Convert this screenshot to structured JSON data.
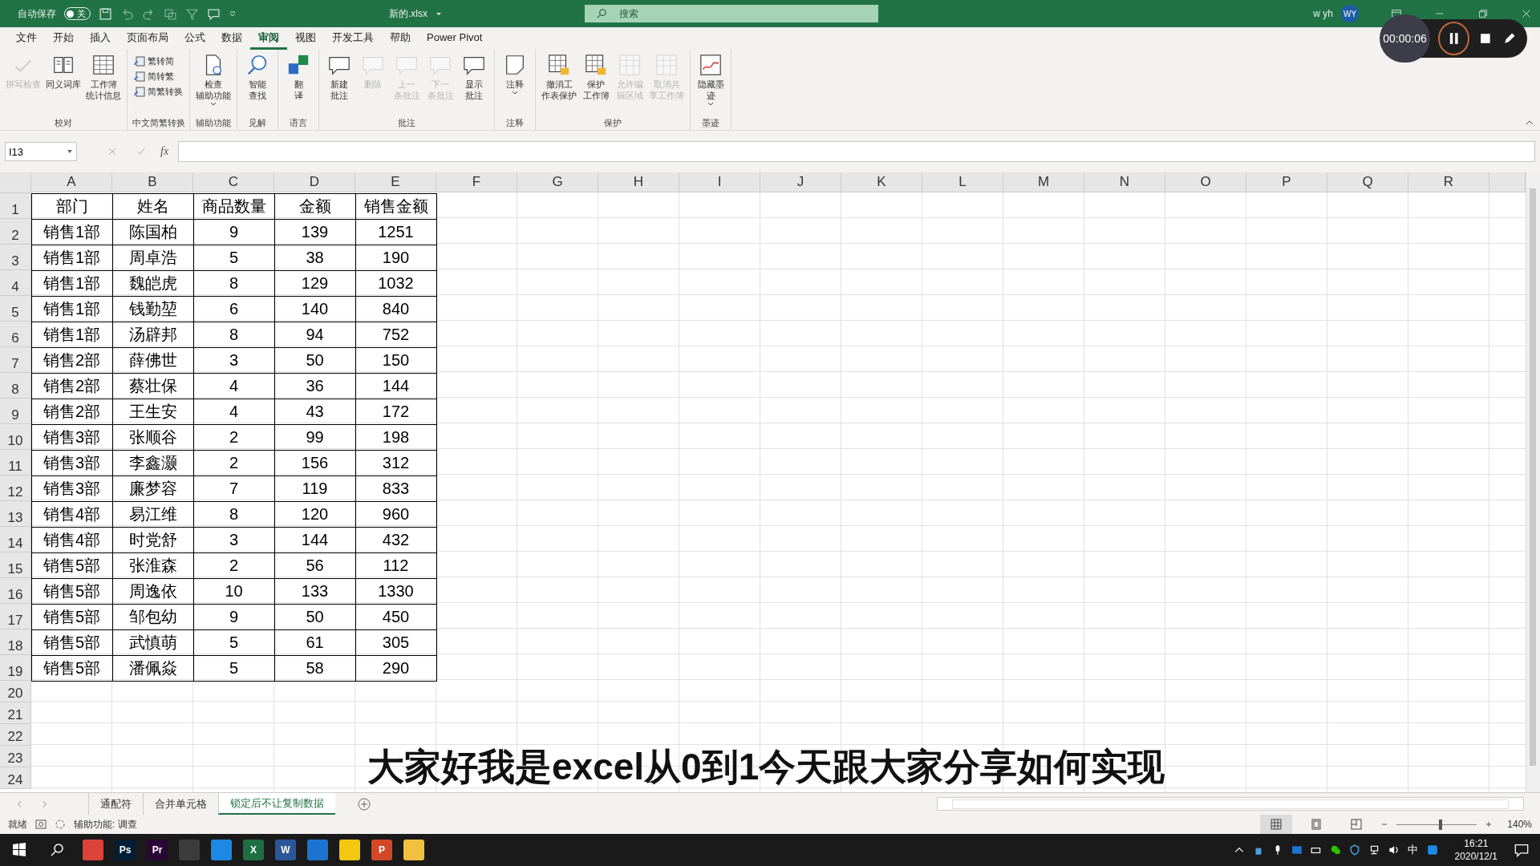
{
  "title_bar": {
    "autosave_label": "自动保存",
    "autosave": {
      "on": false,
      "label": "关"
    },
    "filename": "新的.xlsx",
    "search_placeholder": "搜索",
    "user_name": "w yh",
    "avatar": "WY"
  },
  "menu_tabs": [
    {
      "label": "文件",
      "selected": false
    },
    {
      "label": "开始",
      "selected": false
    },
    {
      "label": "插入",
      "selected": false
    },
    {
      "label": "页面布局",
      "selected": false
    },
    {
      "label": "公式",
      "selected": false
    },
    {
      "label": "数据",
      "selected": false
    },
    {
      "label": "审阅",
      "selected": true
    },
    {
      "label": "视图",
      "selected": false
    },
    {
      "label": "开发工具",
      "selected": false
    },
    {
      "label": "帮助",
      "selected": false
    },
    {
      "label": "Power Pivot",
      "selected": false
    }
  ],
  "ribbon_groups": [
    {
      "label": "校对",
      "kind": "large",
      "buttons": [
        {
          "lines": [
            "拼写检查"
          ],
          "disabled": true,
          "dropdown": false
        },
        {
          "lines": [
            "同义词库"
          ],
          "disabled": false,
          "dropdown": false
        },
        {
          "lines": [
            "工作簿",
            "统计信息"
          ],
          "disabled": false,
          "dropdown": false
        }
      ]
    },
    {
      "label": "中文简繁转换",
      "kind": "small",
      "buttons": [
        {
          "lines": [
            "繁转简"
          ],
          "disabled": false
        },
        {
          "lines": [
            "简转繁"
          ],
          "disabled": false
        },
        {
          "lines": [
            "简繁转换"
          ],
          "disabled": false
        }
      ]
    },
    {
      "label": "辅助功能",
      "kind": "large",
      "buttons": [
        {
          "lines": [
            "检查",
            "辅助功能"
          ],
          "disabled": false,
          "dropdown": true
        }
      ]
    },
    {
      "label": "见解",
      "kind": "large",
      "buttons": [
        {
          "lines": [
            "智能",
            "查找"
          ],
          "disabled": false,
          "dropdown": false
        }
      ]
    },
    {
      "label": "语言",
      "kind": "large",
      "buttons": [
        {
          "lines": [
            "翻",
            "译"
          ],
          "disabled": false,
          "dropdown": false
        }
      ]
    },
    {
      "label": "批注",
      "kind": "large",
      "buttons": [
        {
          "lines": [
            "新建",
            "批注"
          ],
          "disabled": false,
          "dropdown": false
        },
        {
          "lines": [
            "删除"
          ],
          "disabled": true,
          "dropdown": false
        },
        {
          "lines": [
            "上一",
            "条批注"
          ],
          "disabled": true,
          "dropdown": false
        },
        {
          "lines": [
            "下一",
            "条批注"
          ],
          "disabled": true,
          "dropdown": false
        },
        {
          "lines": [
            "显示",
            "批注"
          ],
          "disabled": false,
          "dropdown": false
        }
      ]
    },
    {
      "label": "注释",
      "kind": "large",
      "buttons": [
        {
          "lines": [
            "注释"
          ],
          "disabled": false,
          "dropdown": true
        }
      ]
    },
    {
      "label": "保护",
      "kind": "large",
      "buttons": [
        {
          "lines": [
            "撤消工",
            "作表保护"
          ],
          "disabled": false,
          "dropdown": false
        },
        {
          "lines": [
            "保护",
            "工作簿"
          ],
          "disabled": false,
          "dropdown": false
        },
        {
          "lines": [
            "允许编",
            "辑区域"
          ],
          "disabled": true,
          "dropdown": false
        },
        {
          "lines": [
            "取消共",
            "享工作簿"
          ],
          "disabled": true,
          "dropdown": false
        }
      ]
    },
    {
      "label": "墨迹",
      "kind": "large",
      "buttons": [
        {
          "lines": [
            "隐藏墨",
            "迹"
          ],
          "disabled": false,
          "dropdown": true
        }
      ]
    }
  ],
  "formula_bar": {
    "name_box": "I13",
    "fx": "fx"
  },
  "sheet": {
    "columns": [
      "A",
      "B",
      "C",
      "D",
      "E",
      "F",
      "G",
      "H",
      "I",
      "J",
      "K",
      "L",
      "M",
      "N",
      "O",
      "P",
      "Q",
      "R"
    ],
    "rows": [
      {
        "header": "1",
        "cells": [
          "部门",
          "姓名",
          "商品数量",
          "金额",
          "销售金额"
        ]
      },
      {
        "header": "2",
        "cells": [
          "销售1部",
          "陈国柏",
          "9",
          "139",
          "1251"
        ]
      },
      {
        "header": "3",
        "cells": [
          "销售1部",
          "周卓浩",
          "5",
          "38",
          "190"
        ]
      },
      {
        "header": "4",
        "cells": [
          "销售1部",
          "魏皑虎",
          "8",
          "129",
          "1032"
        ]
      },
      {
        "header": "5",
        "cells": [
          "销售1部",
          "钱勤堃",
          "6",
          "140",
          "840"
        ]
      },
      {
        "header": "6",
        "cells": [
          "销售1部",
          "汤辟邦",
          "8",
          "94",
          "752"
        ]
      },
      {
        "header": "7",
        "cells": [
          "销售2部",
          "薛佛世",
          "3",
          "50",
          "150"
        ]
      },
      {
        "header": "8",
        "cells": [
          "销售2部",
          "蔡壮保",
          "4",
          "36",
          "144"
        ]
      },
      {
        "header": "9",
        "cells": [
          "销售2部",
          "王生安",
          "4",
          "43",
          "172"
        ]
      },
      {
        "header": "10",
        "cells": [
          "销售3部",
          "张顺谷",
          "2",
          "99",
          "198"
        ]
      },
      {
        "header": "11",
        "cells": [
          "销售3部",
          "李鑫灏",
          "2",
          "156",
          "312"
        ]
      },
      {
        "header": "12",
        "cells": [
          "销售3部",
          "廉梦容",
          "7",
          "119",
          "833"
        ]
      },
      {
        "header": "13",
        "cells": [
          "销售4部",
          "易江维",
          "8",
          "120",
          "960"
        ]
      },
      {
        "header": "14",
        "cells": [
          "销售4部",
          "时党舒",
          "3",
          "144",
          "432"
        ]
      },
      {
        "header": "15",
        "cells": [
          "销售5部",
          "张淮森",
          "2",
          "56",
          "112"
        ]
      },
      {
        "header": "16",
        "cells": [
          "销售5部",
          "周逸依",
          "10",
          "133",
          "1330"
        ]
      },
      {
        "header": "17",
        "cells": [
          "销售5部",
          "邹包幼",
          "9",
          "50",
          "450"
        ]
      },
      {
        "header": "18",
        "cells": [
          "销售5部",
          "武慎萌",
          "5",
          "61",
          "305"
        ]
      },
      {
        "header": "19",
        "cells": [
          "销售5部",
          "潘佩焱",
          "5",
          "58",
          "290"
        ]
      },
      {
        "header": "20"
      },
      {
        "header": "21"
      },
      {
        "header": "22"
      },
      {
        "header": "23"
      },
      {
        "header": "24"
      }
    ]
  },
  "caption": "大家好我是excel从0到1今天跟大家分享如何实现",
  "sheet_tabs": [
    {
      "label": "通配符",
      "selected": false
    },
    {
      "label": "合并单元格",
      "selected": false
    },
    {
      "label": "锁定后不让复制数据",
      "selected": true
    }
  ],
  "status_bar": {
    "ready": "就绪",
    "accessibility": "辅助功能: 调查",
    "views": [
      {
        "selected": true
      },
      {
        "selected": false
      },
      {
        "selected": false
      }
    ],
    "zoom": {
      "level": 0.55,
      "label": "140%"
    }
  },
  "taskbar": {
    "apps": [
      {
        "color": "#db4437"
      },
      {
        "label": "Ps",
        "color": "#001e36"
      },
      {
        "label": "Pr",
        "color": "#2a0634"
      },
      {
        "color": "#3c3c3c"
      },
      {
        "color": "#1e88e5"
      },
      {
        "label": "X",
        "color": "#1d6f42"
      },
      {
        "label": "W",
        "color": "#2b579a"
      },
      {
        "color": "#1b74d0"
      },
      {
        "color": "#f2c811"
      },
      {
        "label": "P",
        "color": "#d24726"
      },
      {
        "color": "#f0c040"
      }
    ],
    "ime": "中",
    "time": "16:21",
    "date": "2020/12/1"
  },
  "recorder": {
    "time": "00:00:06"
  }
}
